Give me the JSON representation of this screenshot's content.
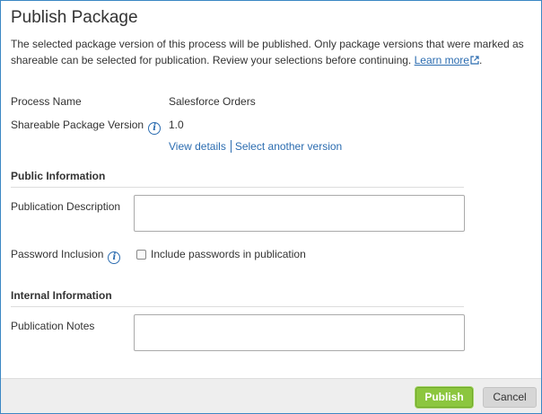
{
  "dialog": {
    "title": "Publish Package",
    "intro_text": "The selected package version of this process will be published. Only package versions that were marked as shareable can be selected for publication. Review your selections before continuing. ",
    "learn_more": "Learn more",
    "intro_end": "."
  },
  "fields": {
    "process_name_label": "Process Name",
    "process_name_value": "Salesforce Orders",
    "version_label": "Shareable Package Version",
    "version_value": "1.0",
    "view_details": "View details",
    "select_another": "Select another version"
  },
  "public_section": {
    "heading": "Public Information",
    "description_label": "Publication Description",
    "description_value": "",
    "password_label": "Password Inclusion",
    "password_checkbox_label": "Include passwords in publication",
    "password_checked": false
  },
  "internal_section": {
    "heading": "Internal Information",
    "notes_label": "Publication Notes",
    "notes_value": ""
  },
  "footer": {
    "publish_label": "Publish",
    "cancel_label": "Cancel"
  },
  "colors": {
    "accent": "#2b6cb0",
    "publish_green": "#8cc63f",
    "border_blue": "#3b87c4"
  }
}
